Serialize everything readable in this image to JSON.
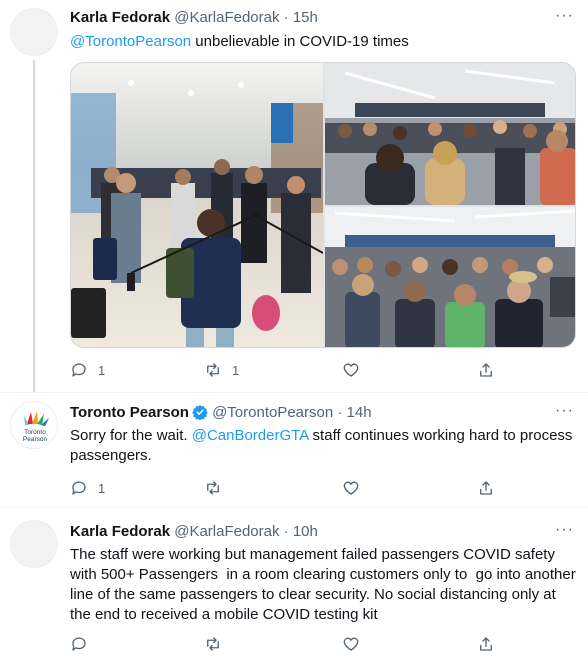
{
  "tweets": [
    {
      "name": "Karla Fedorak",
      "handle": "@KarlaFedorak",
      "time": "· 15h",
      "mention": "@TorontoPearson",
      "text": " unbelievable in COVID-19 times",
      "reply_count": "1",
      "retweet_count": "1",
      "like_count": "",
      "more": "···"
    },
    {
      "name": "Toronto Pearson",
      "handle": "@TorontoPearson",
      "time": "· 14h",
      "avatar_text": "Toronto Pearson",
      "text_before": "Sorry for the wait. ",
      "mention": "@CanBorderGTA",
      "text_after": " staff continues working hard to process passengers.",
      "reply_count": "1",
      "retweet_count": "",
      "like_count": "",
      "more": "···"
    },
    {
      "name": "Karla Fedorak",
      "handle": "@KarlaFedorak",
      "time": "· 10h",
      "text": "The staff were working but management failed passengers COVID safety with 500+ Passengers  in a room clearing customers only to  go into another line of the same passengers to clear security. No social distancing only at the end to received a mobile COVID testing kit",
      "reply_count": "",
      "retweet_count": "",
      "like_count": "",
      "more": "···"
    }
  ],
  "icons": {
    "reply": "reply-icon",
    "retweet": "retweet-icon",
    "like": "heart-icon",
    "share": "share-icon",
    "verified": "verified-badge-icon"
  },
  "colors": {
    "link": "#1d9bf0",
    "secondary_text": "#536471",
    "verified": "#1d9bf0"
  }
}
